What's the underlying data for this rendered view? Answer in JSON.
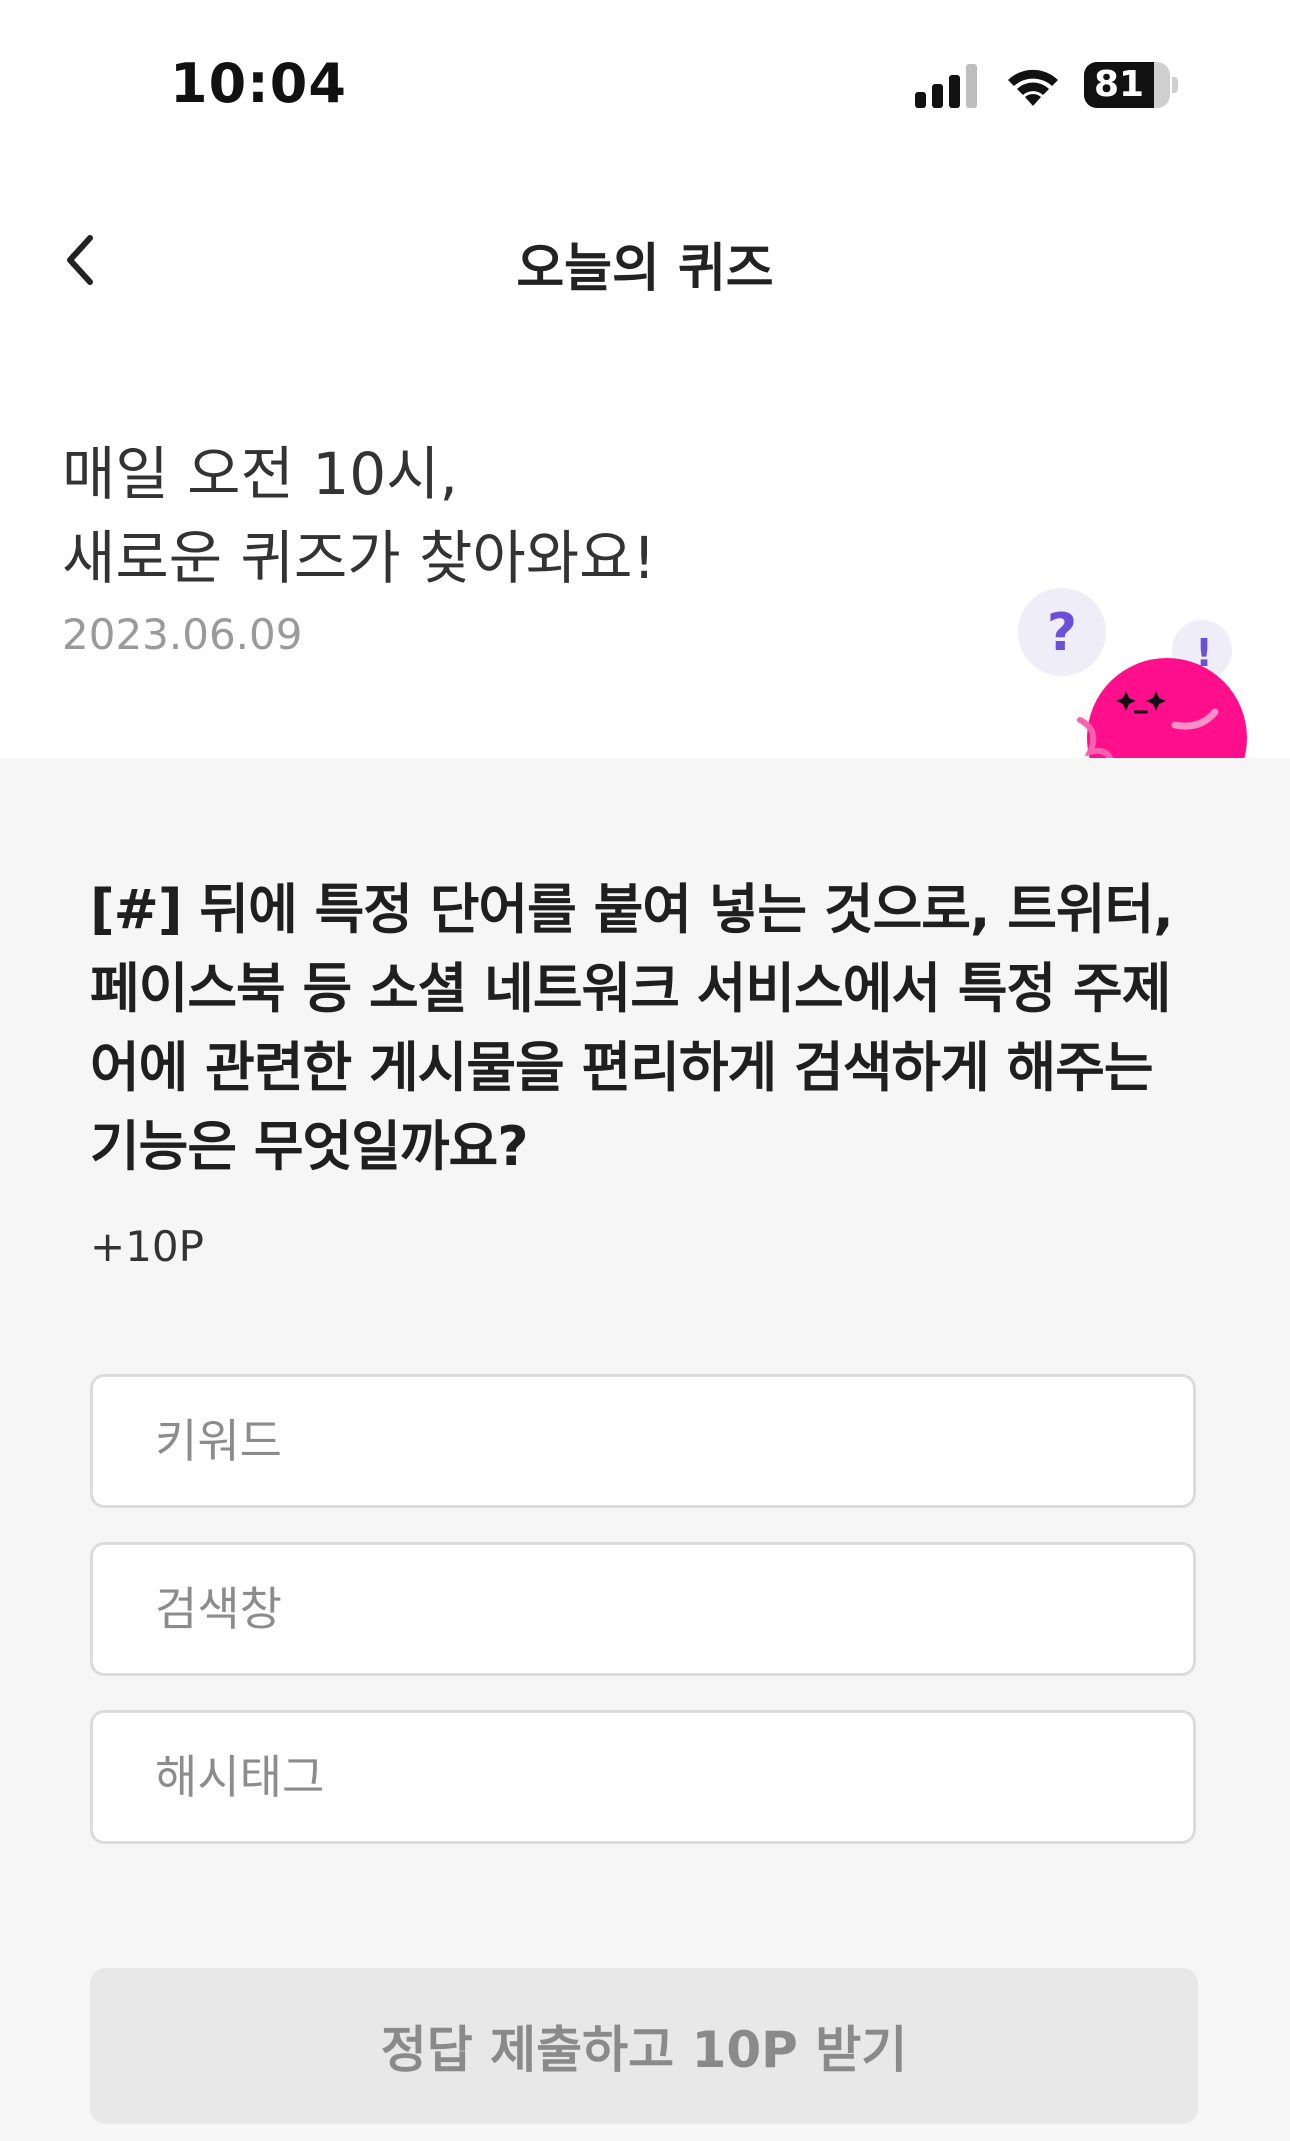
{
  "status_bar": {
    "time": "10:04",
    "battery_level": "81",
    "battery_fraction": 0.81
  },
  "header": {
    "title": "오늘의 퀴즈",
    "back_icon": "chevron-left-icon"
  },
  "intro": {
    "line1": "매일 오전 10시,",
    "line2": "새로운 퀴즈가 찾아와요!",
    "date": "2023.06.09"
  },
  "mascot": {
    "question_mark": "?",
    "exclamation_mark": "!",
    "color": "#ff0f8b"
  },
  "quiz": {
    "question": "[#] 뒤에 특정 단어를 붙여 넣는 것으로, 트위터, 페이스북 등 소셜 네트워크 서비스에서 특정 주제어에 관련한 게시물을 편리하게 검색하게 해주는 기능은 무엇일까요?",
    "points": "+10P",
    "options": [
      {
        "label": "키워드"
      },
      {
        "label": "검색창"
      },
      {
        "label": "해시태그"
      }
    ],
    "submit_label": "정답 제출하고 10P 받기"
  },
  "colors": {
    "background_top": "#ffffff",
    "background_quiz": "#f6f6f6",
    "option_border": "#dcdcdc",
    "submit_disabled_bg": "#e8e8e8",
    "submit_disabled_text": "#8a8a8a",
    "accent_purple": "#6b4fd6",
    "accent_pink": "#ff0f8b"
  }
}
